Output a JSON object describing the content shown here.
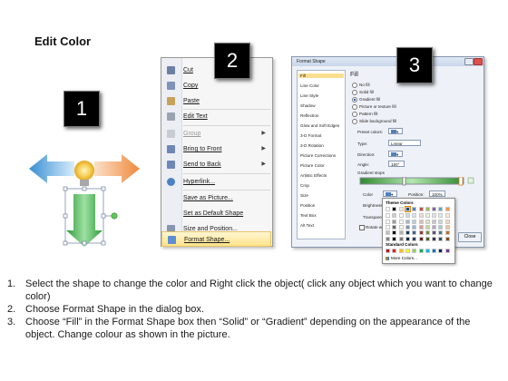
{
  "page": {
    "title": "Edit Color"
  },
  "numbers": [
    "1",
    "2",
    "3"
  ],
  "context_menu": {
    "items": [
      {
        "label": "Cut",
        "icon": "scissors-icon",
        "disabled": false,
        "submenu": false
      },
      {
        "label": "Copy",
        "icon": "copy-icon",
        "disabled": false,
        "submenu": false
      },
      {
        "label": "Paste",
        "icon": "paste-icon",
        "disabled": false,
        "submenu": false
      },
      {
        "label": "Edit Text",
        "icon": "edit-text-icon",
        "disabled": false,
        "submenu": false
      },
      {
        "label": "Group",
        "icon": "group-icon",
        "disabled": true,
        "submenu": true
      },
      {
        "label": "Bring to Front",
        "icon": "bring-front-icon",
        "disabled": false,
        "submenu": true
      },
      {
        "label": "Send to Back",
        "icon": "send-back-icon",
        "disabled": false,
        "submenu": true
      },
      {
        "label": "Hyperlink...",
        "icon": "hyperlink-icon",
        "disabled": false,
        "submenu": false
      },
      {
        "label": "Save as Picture...",
        "icon": "",
        "disabled": false,
        "submenu": false
      },
      {
        "label": "Set as Default Shape",
        "icon": "",
        "disabled": false,
        "submenu": false
      },
      {
        "label": "Size and Position...",
        "icon": "size-position-icon",
        "disabled": false,
        "submenu": false
      },
      {
        "label": "Format Shape...",
        "icon": "format-shape-icon",
        "disabled": false,
        "submenu": false,
        "highlighted": true
      }
    ]
  },
  "format_dialog": {
    "title": "Format Shape",
    "sidebar": [
      "Fill",
      "Line Color",
      "Line Style",
      "Shadow",
      "Reflection",
      "Glow and Soft Edges",
      "3-D Format",
      "3-D Rotation",
      "Picture Corrections",
      "Picture Color",
      "Artistic Effects",
      "Crop",
      "Size",
      "Position",
      "Text Box",
      "Alt Text"
    ],
    "selected_sidebar": "Fill",
    "fill_heading": "Fill",
    "fill_options": [
      "No fill",
      "Solid fill",
      "Gradient fill",
      "Picture or texture fill",
      "Pattern fill",
      "Slide background fill"
    ],
    "selected_fill": "Gradient fill",
    "preset_colors_label": "Preset colors:",
    "type_label": "Type:",
    "type_value": "Linear",
    "direction_label": "Direction:",
    "angle_label": "Angle:",
    "angle_value": "180°",
    "gradient_stops_label": "Gradient stops",
    "color_label": "Color",
    "position_label": "Position:",
    "position_value": "100%",
    "brightness_label": "Brightness:",
    "transparency_label": "Transparency:",
    "rotate_label": "Rotate w",
    "close_label": "Close"
  },
  "palette": {
    "theme_label": "Theme Colors",
    "standard_label": "Standard Colors",
    "more_label": "More Colors...",
    "theme_top": [
      "#ffffff",
      "#000000",
      "#eeece1",
      "#1f497d",
      "#4f81bd",
      "#c0504d",
      "#9bbb59",
      "#8064a2",
      "#4bacc6",
      "#f79646"
    ],
    "standard": [
      "#c00000",
      "#ff0000",
      "#ffc000",
      "#ffff00",
      "#92d050",
      "#00b050",
      "#00b0f0",
      "#0070c0",
      "#002060",
      "#7030a0"
    ],
    "selected_index": 3
  },
  "colors": {
    "accent": "#2f8a2f",
    "arrow_left": "#4aa5e0",
    "arrow_right": "#f0a060",
    "shape_green": "#3fae49"
  },
  "steps": [
    {
      "num": "1.",
      "text": "Select the shape to change the color and Right click the object( click any object which you want to change color)"
    },
    {
      "num": "2.",
      "text": "Choose Format Shape in the dialog box."
    },
    {
      "num": "3.",
      "text": "Choose “Fill” in the Format Shape box then “Solid” or “Gradient” depending on the appearance of the object. Change colour as shown in the picture."
    }
  ]
}
